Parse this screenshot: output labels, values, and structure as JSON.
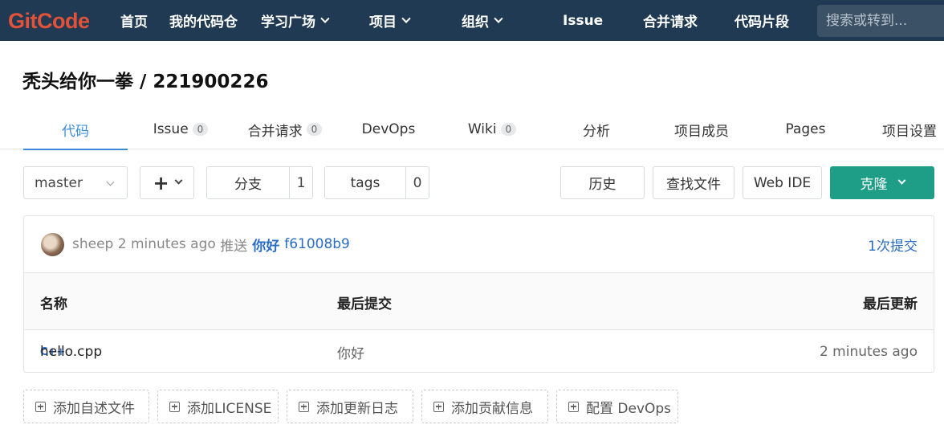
{
  "header": {
    "logo": "GitCode",
    "nav": [
      {
        "label": "首页",
        "dropdown": false
      },
      {
        "label": "我的代码仓",
        "dropdown": false
      },
      {
        "label": "学习广场",
        "dropdown": true
      },
      {
        "label": "项目",
        "dropdown": true
      },
      {
        "label": "组织",
        "dropdown": true
      },
      {
        "label": "Issue",
        "dropdown": false
      },
      {
        "label": "合并请求",
        "dropdown": false
      },
      {
        "label": "代码片段",
        "dropdown": false
      }
    ],
    "search_placeholder": "搜索或转到..."
  },
  "project": {
    "title": "秃头给你一拳 / 221900226"
  },
  "tabs": [
    {
      "label": "代码",
      "active": true
    },
    {
      "label": "Issue",
      "count": "0"
    },
    {
      "label": "合并请求",
      "count": "0"
    },
    {
      "label": "DevOps"
    },
    {
      "label": "Wiki",
      "count": "0"
    },
    {
      "label": "分析"
    },
    {
      "label": "项目成员"
    },
    {
      "label": "Pages"
    },
    {
      "label": "项目设置"
    }
  ],
  "toolbar": {
    "branch": "master",
    "plus": "+",
    "branches_label": "分支",
    "branches_count": "1",
    "tags_label": "tags",
    "tags_count": "0",
    "history": "历史",
    "find_file": "查找文件",
    "web_ide": "Web IDE",
    "clone": "克隆"
  },
  "last_commit": {
    "author": "sheep",
    "time": "2 minutes ago",
    "action": "推送",
    "message": "你好",
    "sha": "f61008b9",
    "commit_count": "1次提交"
  },
  "file_table": {
    "headers": [
      "名称",
      "最后提交",
      "最后更新"
    ],
    "rows": [
      {
        "icon": "C++",
        "name": "hello.cpp",
        "last_commit": "你好",
        "updated": "2 minutes ago"
      }
    ]
  },
  "add_buttons": [
    "添加自述文件",
    "添加LICENSE",
    "添加更新日志",
    "添加贡献信息",
    "配置 DevOps"
  ],
  "colors": {
    "nav_bg": "#1f3a52",
    "logo": "#e2513a",
    "accent": "#3b8cd8",
    "link": "#2a6dc4",
    "clone_btn": "#1e9e86"
  }
}
